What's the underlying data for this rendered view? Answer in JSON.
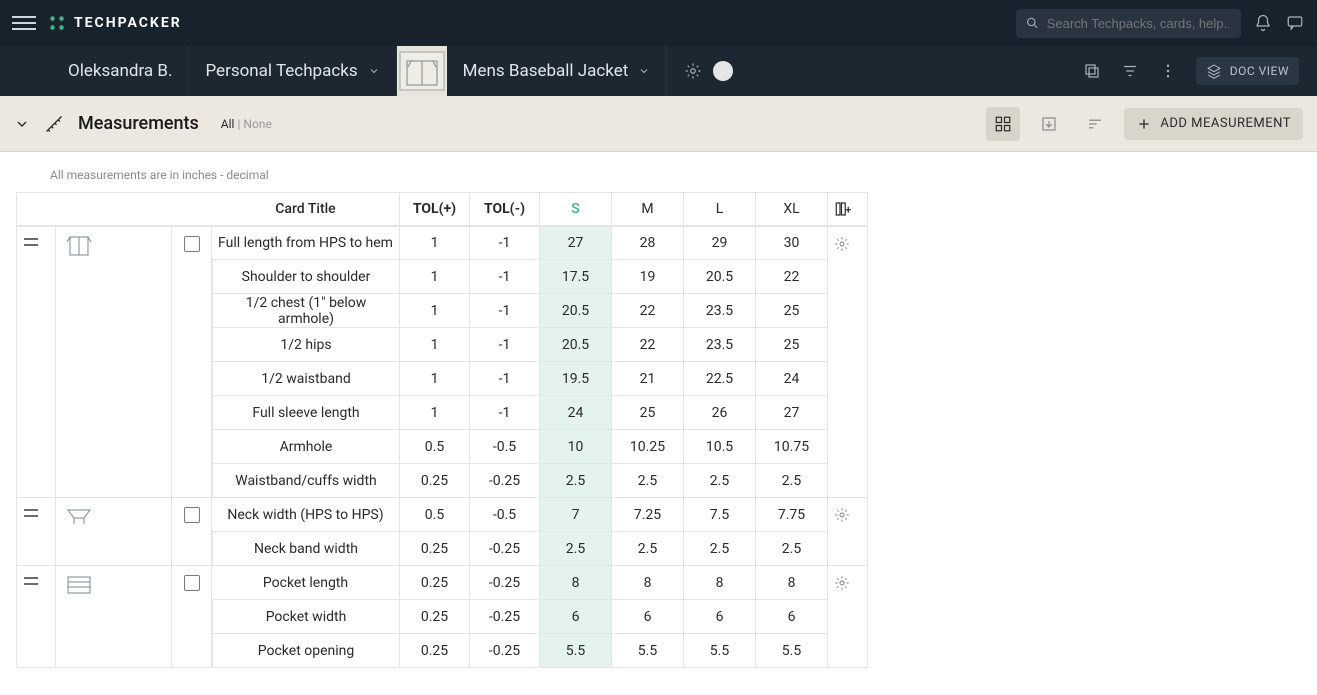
{
  "brand": "TECHPACKER",
  "search": {
    "placeholder": "Search Techpacks, cards, help..."
  },
  "breadcrumb": {
    "user": "Oleksandra B.",
    "workspace": "Personal Techpacks",
    "project": "Mens Baseball Jacket"
  },
  "doc_view_label": "DOC VIEW",
  "section": {
    "title": "Measurements",
    "filter_all": "All",
    "filter_none": "None",
    "add_label": "ADD MEASUREMENT"
  },
  "units_note": "All measurements are in inches - decimal",
  "columns": {
    "card_title": "Card Title",
    "tol_plus": "TOL(+)",
    "tol_minus": "TOL(-)",
    "sizes": [
      "S",
      "M",
      "L",
      "XL"
    ]
  },
  "groups": [
    {
      "thumb": "jacket-body",
      "rows": [
        {
          "title": "Full length from HPS to hem",
          "tolp": "1",
          "tolm": "-1",
          "vals": [
            "27",
            "28",
            "29",
            "30"
          ]
        },
        {
          "title": "Shoulder to shoulder",
          "tolp": "1",
          "tolm": "-1",
          "vals": [
            "17.5",
            "19",
            "20.5",
            "22"
          ]
        },
        {
          "title": "1/2 chest (1\" below armhole)",
          "tolp": "1",
          "tolm": "-1",
          "vals": [
            "20.5",
            "22",
            "23.5",
            "25"
          ]
        },
        {
          "title": "1/2 hips",
          "tolp": "1",
          "tolm": "-1",
          "vals": [
            "20.5",
            "22",
            "23.5",
            "25"
          ]
        },
        {
          "title": "1/2 waistband",
          "tolp": "1",
          "tolm": "-1",
          "vals": [
            "19.5",
            "21",
            "22.5",
            "24"
          ]
        },
        {
          "title": "Full sleeve length",
          "tolp": "1",
          "tolm": "-1",
          "vals": [
            "24",
            "25",
            "26",
            "27"
          ]
        },
        {
          "title": "Armhole",
          "tolp": "0.5",
          "tolm": "-0.5",
          "vals": [
            "10",
            "10.25",
            "10.5",
            "10.75"
          ]
        },
        {
          "title": "Waistband/cuffs width",
          "tolp": "0.25",
          "tolm": "-0.25",
          "vals": [
            "2.5",
            "2.5",
            "2.5",
            "2.5"
          ]
        }
      ]
    },
    {
      "thumb": "collar",
      "rows": [
        {
          "title": "Neck width (HPS to HPS)",
          "tolp": "0.5",
          "tolm": "-0.5",
          "vals": [
            "7",
            "7.25",
            "7.5",
            "7.75"
          ]
        },
        {
          "title": "Neck band width",
          "tolp": "0.25",
          "tolm": "-0.25",
          "vals": [
            "2.5",
            "2.5",
            "2.5",
            "2.5"
          ]
        }
      ]
    },
    {
      "thumb": "pocket",
      "rows": [
        {
          "title": "Pocket length",
          "tolp": "0.25",
          "tolm": "-0.25",
          "vals": [
            "8",
            "8",
            "8",
            "8"
          ]
        },
        {
          "title": "Pocket width",
          "tolp": "0.25",
          "tolm": "-0.25",
          "vals": [
            "6",
            "6",
            "6",
            "6"
          ]
        },
        {
          "title": "Pocket opening",
          "tolp": "0.25",
          "tolm": "-0.25",
          "vals": [
            "5.5",
            "5.5",
            "5.5",
            "5.5"
          ]
        }
      ]
    }
  ]
}
